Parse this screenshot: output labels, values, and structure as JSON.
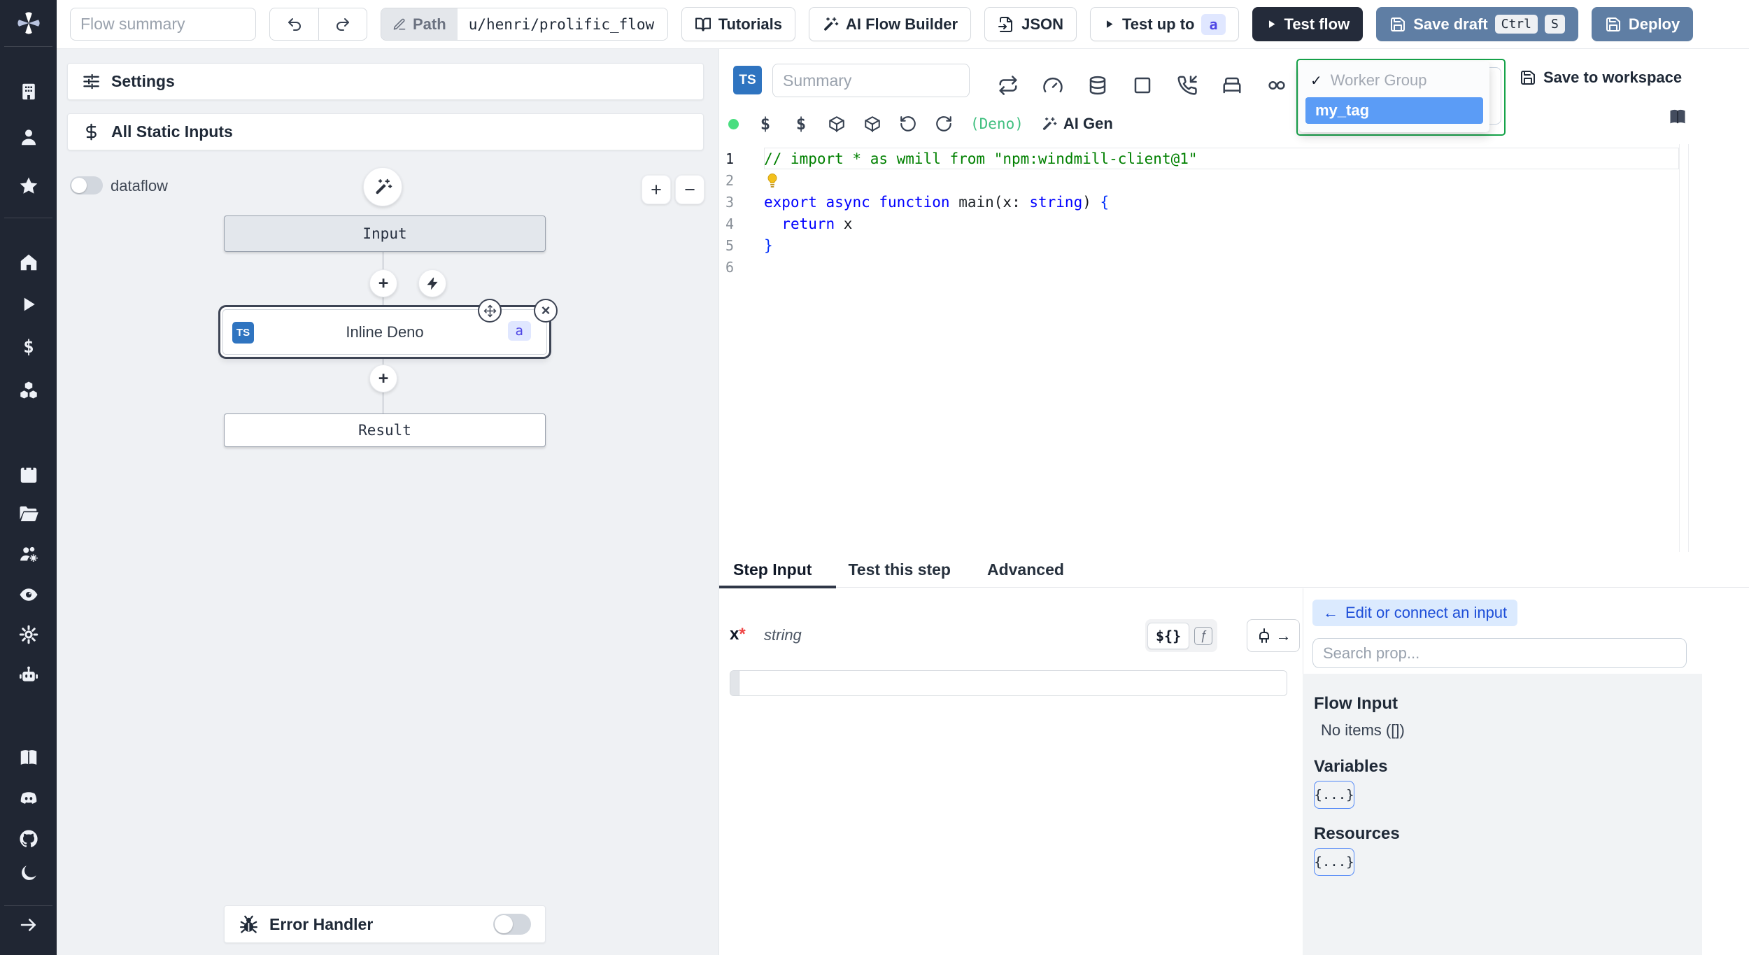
{
  "colors": {
    "sidebar_bg": "#202633",
    "accent_blue": "#2f74c0",
    "success_green": "#16a34a",
    "status_dot_green": "#4ade80",
    "runtime_green": "#3fbf7f",
    "slate_button": "#5f7ea4",
    "dark_button": "#242b3a",
    "selection_blue": "#5b9cf6",
    "badge_indigo_bg": "#e0e7ff",
    "badge_indigo_text": "#4f46e5",
    "link_blue": "#1d4ed8"
  },
  "topbar": {
    "flow_summary_placeholder": "Flow summary",
    "path_label": "Path",
    "path_value": "u/henri/prolific_flow",
    "tutorials_label": "Tutorials",
    "ai_flow_builder_label": "AI Flow Builder",
    "json_label": "JSON",
    "test_up_to_label": "Test up to",
    "test_up_to_badge": "a",
    "test_flow_label": "Test flow",
    "save_draft_label": "Save draft",
    "shortcut_keys": [
      "Ctrl",
      "S"
    ],
    "deploy_label": "Deploy"
  },
  "sidebar": {
    "icons": [
      "building-icon",
      "user-icon",
      "star-icon",
      "home-icon",
      "play-icon",
      "dollar-icon",
      "boxes-icon",
      "calendar-icon",
      "folder-open-icon",
      "users-gear-icon",
      "eye-icon",
      "gear-icon",
      "bot-icon",
      "book-icon",
      "discord-icon",
      "github-icon",
      "moon-icon",
      "arrow-right-icon"
    ]
  },
  "flow_panel": {
    "settings_label": "Settings",
    "all_static_inputs_label": "All Static Inputs",
    "dataflow_label": "dataflow",
    "zoom_in": "+",
    "zoom_out": "−",
    "input_node_label": "Input",
    "step_node": {
      "lang_badge": "TS",
      "title": "Inline Deno",
      "id_badge": "a"
    },
    "result_node_label": "Result",
    "error_handler_label": "Error Handler"
  },
  "editor": {
    "lang_badge": "TS",
    "summary_placeholder": "Summary",
    "toolbar_icons": [
      "repeat-icon",
      "gauge-icon",
      "database-icon",
      "square-icon",
      "phone-incoming-icon",
      "bed-icon",
      "loop-icon"
    ],
    "quick_icons": [
      "dollar-icon",
      "dollar-icon",
      "package-icon",
      "package-icon",
      "rotate-ccw-icon",
      "refresh-cw-icon"
    ],
    "runtime_label": "(Deno)",
    "ai_gen_label": "AI Gen",
    "save_to_workspace_label": "Save to workspace",
    "worker_group_menu": {
      "group_label": "Worker Group",
      "check": "✓",
      "selected_option": "my_tag"
    },
    "code": {
      "lines": [
        {
          "n": "1",
          "current": true,
          "tokens": [
            {
              "c": "comment",
              "t": "// import * as wmill from \"npm:windmill-client@1\""
            }
          ]
        },
        {
          "n": "2",
          "tokens": [
            {
              "c": "bulb",
              "t": ""
            }
          ]
        },
        {
          "n": "3",
          "tokens": [
            {
              "c": "kw",
              "t": "export"
            },
            {
              "c": "pl",
              "t": " "
            },
            {
              "c": "kw",
              "t": "async"
            },
            {
              "c": "pl",
              "t": " "
            },
            {
              "c": "kw",
              "t": "function"
            },
            {
              "c": "pl",
              "t": " "
            },
            {
              "c": "fn",
              "t": "main"
            },
            {
              "c": "pl",
              "t": "(x: "
            },
            {
              "c": "kw",
              "t": "string"
            },
            {
              "c": "pl",
              "t": ") "
            },
            {
              "c": "brace",
              "t": "{"
            }
          ]
        },
        {
          "n": "4",
          "tokens": [
            {
              "c": "pl",
              "t": "  "
            },
            {
              "c": "kw",
              "t": "return"
            },
            {
              "c": "pl",
              "t": " x"
            }
          ]
        },
        {
          "n": "5",
          "tokens": [
            {
              "c": "brace",
              "t": "}"
            }
          ]
        },
        {
          "n": "6",
          "tokens": []
        }
      ]
    }
  },
  "step_panel": {
    "tabs": [
      "Step Input",
      "Test this step",
      "Advanced"
    ],
    "active_tab": "Step Input",
    "field_name": "x",
    "field_required_marker": "*",
    "field_type": "string",
    "template_toggle_label": "${}",
    "function_toggle_label": "ƒ",
    "plug_arrow": "→",
    "input_value": ""
  },
  "connect_panel": {
    "back_arrow": "←",
    "edit_or_connect_label": "Edit or connect an input",
    "search_placeholder": "Search prop...",
    "flow_input_title": "Flow Input",
    "flow_input_empty": "No items ([])",
    "variables_title": "Variables",
    "resources_title": "Resources",
    "object_button_label": "{...}"
  }
}
